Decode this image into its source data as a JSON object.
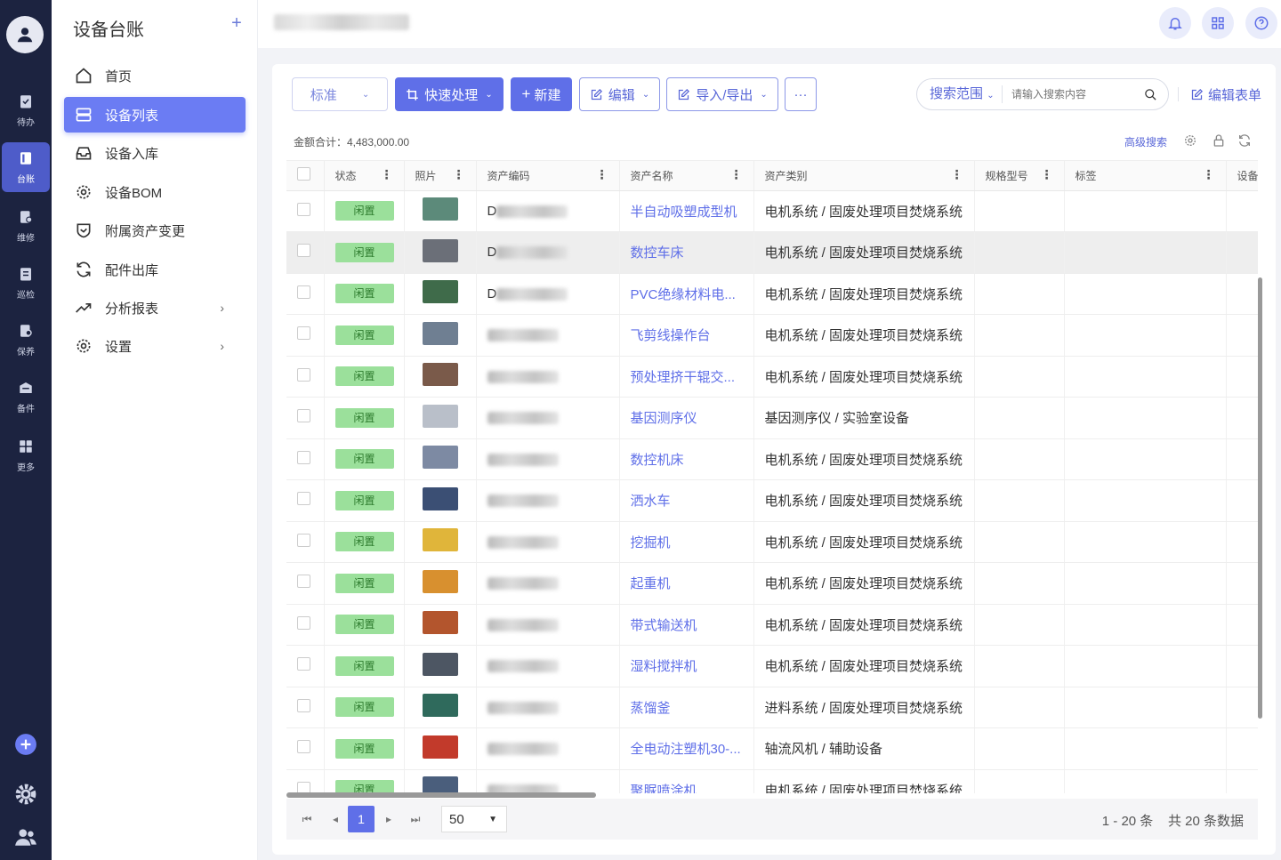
{
  "rail": {
    "items": [
      {
        "label": "待办",
        "icon": "clipboard-check-icon"
      },
      {
        "label": "台账",
        "icon": "ledger-book-icon"
      },
      {
        "label": "维修",
        "icon": "repair-doc-icon"
      },
      {
        "label": "巡检",
        "icon": "inspection-clipboard-icon"
      },
      {
        "label": "保养",
        "icon": "maintenance-doc-icon"
      },
      {
        "label": "备件",
        "icon": "spare-parts-icon"
      },
      {
        "label": "更多",
        "icon": "grid-more-icon"
      }
    ]
  },
  "sidebar": {
    "title": "设备台账",
    "items": [
      {
        "label": "首页",
        "icon": "home-icon"
      },
      {
        "label": "设备列表",
        "icon": "list-icon"
      },
      {
        "label": "设备入库",
        "icon": "inbox-icon"
      },
      {
        "label": "设备BOM",
        "icon": "gear-icon"
      },
      {
        "label": "附属资产变更",
        "icon": "shield-check-icon"
      },
      {
        "label": "配件出库",
        "icon": "refresh-icon"
      },
      {
        "label": "分析报表",
        "icon": "trend-icon"
      },
      {
        "label": "设置",
        "icon": "settings-icon"
      }
    ]
  },
  "toolbar": {
    "view_select": "标准",
    "quick_process": "快速处理",
    "new": "新建",
    "edit": "编辑",
    "import_export": "导入/导出",
    "more": "···",
    "search_scope": "搜索范围",
    "search_placeholder": "请输入搜索内容",
    "edit_form": "编辑表单"
  },
  "summary": {
    "total": "金额合计：4,483,000.00",
    "advanced_search": "高级搜索"
  },
  "table": {
    "columns": [
      "状态",
      "照片",
      "资产编码",
      "资产名称",
      "资产类别",
      "规格型号",
      "标签",
      "设备"
    ],
    "rows": [
      {
        "status": "闲置",
        "code_prefix": "D",
        "name": "半自动吸塑成型机",
        "category": "电机系统 / 固废处理项目焚烧系统",
        "thumb": "#5c8a7a"
      },
      {
        "status": "闲置",
        "code_prefix": "D",
        "name": "数控车床",
        "category": "电机系统 / 固废处理项目焚烧系统",
        "thumb": "#6b6f78"
      },
      {
        "status": "闲置",
        "code_prefix": "D",
        "name": "PVC绝缘材料电...",
        "category": "电机系统 / 固废处理项目焚烧系统",
        "thumb": "#3f6b4a"
      },
      {
        "status": "闲置",
        "code_prefix": "",
        "name": "飞剪线操作台",
        "category": "电机系统 / 固废处理项目焚烧系统",
        "thumb": "#6f7f92"
      },
      {
        "status": "闲置",
        "code_prefix": "",
        "name": "预处理挤干辊交...",
        "category": "电机系统 / 固废处理项目焚烧系统",
        "thumb": "#7a5a4a"
      },
      {
        "status": "闲置",
        "code_prefix": "",
        "name": "基因测序仪",
        "category": "基因测序仪 / 实验室设备",
        "thumb": "#b9bfc9"
      },
      {
        "status": "闲置",
        "code_prefix": "",
        "name": "数控机床",
        "category": "电机系统 / 固废处理项目焚烧系统",
        "thumb": "#7d8aa3"
      },
      {
        "status": "闲置",
        "code_prefix": "",
        "name": "洒水车",
        "category": "电机系统 / 固废处理项目焚烧系统",
        "thumb": "#3b4f74"
      },
      {
        "status": "闲置",
        "code_prefix": "",
        "name": "挖掘机",
        "category": "电机系统 / 固废处理项目焚烧系统",
        "thumb": "#e0b53a"
      },
      {
        "status": "闲置",
        "code_prefix": "",
        "name": "起重机",
        "category": "电机系统 / 固废处理项目焚烧系统",
        "thumb": "#d8902f"
      },
      {
        "status": "闲置",
        "code_prefix": "",
        "name": "带式输送机",
        "category": "电机系统 / 固废处理项目焚烧系统",
        "thumb": "#b3552d"
      },
      {
        "status": "闲置",
        "code_prefix": "",
        "name": "湿料搅拌机",
        "category": "电机系统 / 固废处理项目焚烧系统",
        "thumb": "#4d5663"
      },
      {
        "status": "闲置",
        "code_prefix": "",
        "name": "蒸馏釜",
        "category": "进料系统 / 固废处理项目焚烧系统",
        "thumb": "#2f6a5c"
      },
      {
        "status": "闲置",
        "code_prefix": "",
        "name": "全电动注塑机30-...",
        "category": "轴流风机 / 辅助设备",
        "thumb": "#c23a2b"
      },
      {
        "status": "闲置",
        "code_prefix": "",
        "name": "聚脲喷涂机",
        "category": "电机系统 / 固废处理项目焚烧系统",
        "thumb": "#4a5e7c"
      }
    ]
  },
  "pager": {
    "current": "1",
    "page_size": "50",
    "info": "1 - 20 条    共 20 条数据"
  },
  "colors": {
    "accent": "#5f6fe8",
    "rail_bg": "#1c2340",
    "status_green": "#9be09b"
  }
}
